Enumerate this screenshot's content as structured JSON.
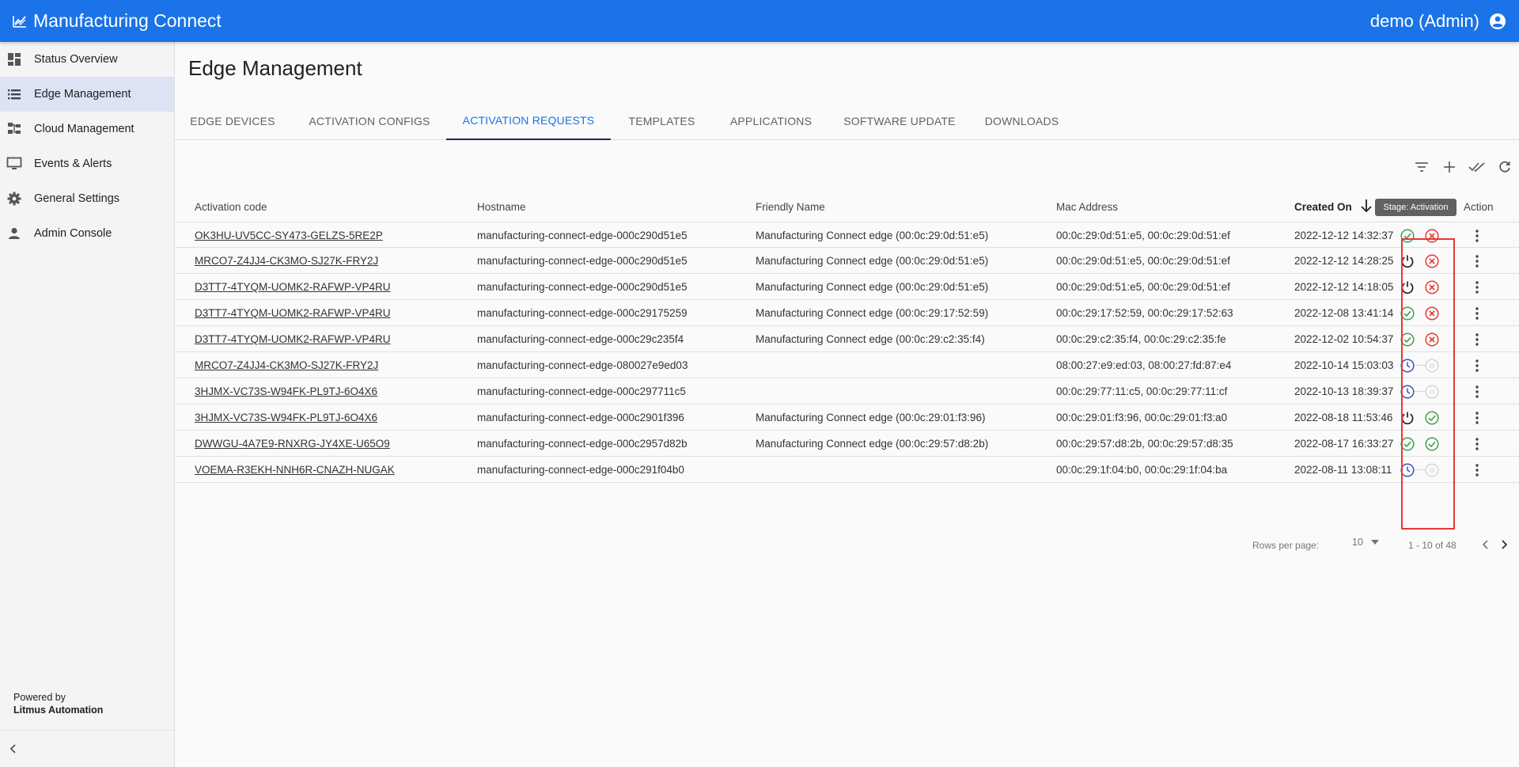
{
  "app": {
    "title": "Manufacturing Connect",
    "user": "demo (Admin)"
  },
  "sidebar": {
    "items": [
      {
        "label": "Status Overview",
        "icon": "dashboard-icon"
      },
      {
        "label": "Edge Management",
        "icon": "list-icon"
      },
      {
        "label": "Cloud Management",
        "icon": "hierarchy-icon"
      },
      {
        "label": "Events & Alerts",
        "icon": "monitor-icon"
      },
      {
        "label": "General Settings",
        "icon": "gear-icon"
      },
      {
        "label": "Admin Console",
        "icon": "person-icon"
      }
    ],
    "powered_by": "Powered by",
    "company": "Litmus Automation"
  },
  "page": {
    "title": "Edge Management"
  },
  "tabs": [
    "EDGE DEVICES",
    "ACTIVATION CONFIGS",
    "ACTIVATION REQUESTS",
    "TEMPLATES",
    "APPLICATIONS",
    "SOFTWARE UPDATE",
    "DOWNLOADS"
  ],
  "active_tab": "ACTIVATION REQUESTS",
  "table": {
    "headers": {
      "code": "Activation code",
      "hostname": "Hostname",
      "friendly": "Friendly Name",
      "mac": "Mac Address",
      "created": "Created On",
      "action": "Action"
    },
    "tooltip": "Stage: Activation",
    "rows": [
      {
        "code": "OK3HU-UV5CC-SY473-GELZS-5RE2P",
        "hostname": "manufacturing-connect-edge-000c290d51e5",
        "friendly": "Manufacturing Connect edge (00:0c:29:0d:51:e5)",
        "mac": "00:0c:29:0d:51:e5, 00:0c:29:0d:51:ef",
        "created": "2022-12-12 14:32:37",
        "s1": "check",
        "s2": "error"
      },
      {
        "code": "MRCO7-Z4JJ4-CK3MO-SJ27K-FRY2J",
        "hostname": "manufacturing-connect-edge-000c290d51e5",
        "friendly": "Manufacturing Connect edge (00:0c:29:0d:51:e5)",
        "mac": "00:0c:29:0d:51:e5, 00:0c:29:0d:51:ef",
        "created": "2022-12-12 14:28:25",
        "s1": "power",
        "s2": "error"
      },
      {
        "code": "D3TT7-4TYQM-UOMK2-RAFWP-VP4RU",
        "hostname": "manufacturing-connect-edge-000c290d51e5",
        "friendly": "Manufacturing Connect edge (00:0c:29:0d:51:e5)",
        "mac": "00:0c:29:0d:51:e5, 00:0c:29:0d:51:ef",
        "created": "2022-12-12 14:18:05",
        "s1": "power",
        "s2": "error"
      },
      {
        "code": "D3TT7-4TYQM-UOMK2-RAFWP-VP4RU",
        "hostname": "manufacturing-connect-edge-000c29175259",
        "friendly": "Manufacturing Connect edge (00:0c:29:17:52:59)",
        "mac": "00:0c:29:17:52:59, 00:0c:29:17:52:63",
        "created": "2022-12-08 13:41:14",
        "s1": "check",
        "s2": "error"
      },
      {
        "code": "D3TT7-4TYQM-UOMK2-RAFWP-VP4RU",
        "hostname": "manufacturing-connect-edge-000c29c235f4",
        "friendly": "Manufacturing Connect edge (00:0c:29:c2:35:f4)",
        "mac": "00:0c:29:c2:35:f4, 00:0c:29:c2:35:fe",
        "created": "2022-12-02 10:54:37",
        "s1": "check",
        "s2": "error"
      },
      {
        "code": "MRCO7-Z4JJ4-CK3MO-SJ27K-FRY2J",
        "hostname": "manufacturing-connect-edge-080027e9ed03",
        "friendly": "",
        "mac": "08:00:27:e9:ed:03, 08:00:27:fd:87:e4",
        "created": "2022-10-14 15:03:03",
        "s1": "clock",
        "s2": "pending"
      },
      {
        "code": "3HJMX-VC73S-W94FK-PL9TJ-6O4X6",
        "hostname": "manufacturing-connect-edge-000c297711c5",
        "friendly": "",
        "mac": "00:0c:29:77:11:c5, 00:0c:29:77:11:cf",
        "created": "2022-10-13 18:39:37",
        "s1": "clock",
        "s2": "pending"
      },
      {
        "code": "3HJMX-VC73S-W94FK-PL9TJ-6O4X6",
        "hostname": "manufacturing-connect-edge-000c2901f396",
        "friendly": "Manufacturing Connect edge (00:0c:29:01:f3:96)",
        "mac": "00:0c:29:01:f3:96, 00:0c:29:01:f3:a0",
        "created": "2022-08-18 11:53:46",
        "s1": "power",
        "s2": "check"
      },
      {
        "code": "DWWGU-4A7E9-RNXRG-JY4XE-U65O9",
        "hostname": "manufacturing-connect-edge-000c2957d82b",
        "friendly": "Manufacturing Connect edge (00:0c:29:57:d8:2b)",
        "mac": "00:0c:29:57:d8:2b, 00:0c:29:57:d8:35",
        "created": "2022-08-17 16:33:27",
        "s1": "check",
        "s2": "check"
      },
      {
        "code": "VOEMA-R3EKH-NNH6R-CNAZH-NUGAK",
        "hostname": "manufacturing-connect-edge-000c291f04b0",
        "friendly": "",
        "mac": "00:0c:29:1f:04:b0, 00:0c:29:1f:04:ba",
        "created": "2022-08-11 13:08:11",
        "s1": "clock",
        "s2": "pending"
      }
    ]
  },
  "pagination": {
    "rows_per_page_label": "Rows per page:",
    "rows_per_page": "10",
    "range": "1 - 10 of 48"
  },
  "colors": {
    "primary": "#1a73e8",
    "success": "#43a047",
    "error": "#e53935",
    "pending": "#3f51b5",
    "highlight": "#e53935"
  }
}
